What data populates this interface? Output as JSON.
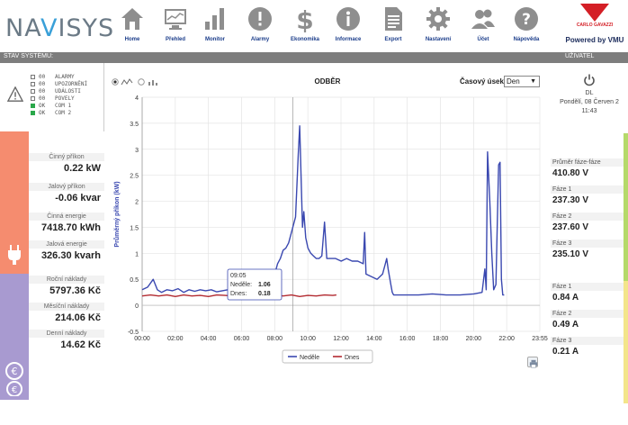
{
  "app": {
    "logo_text": "NAVISYS",
    "brand_name": "CARLO GAVAZZI",
    "powered_by": "Powered by VMU"
  },
  "nav": [
    {
      "label": "Home",
      "icon": "home-icon"
    },
    {
      "label": "Přehled",
      "icon": "monitor-icon"
    },
    {
      "label": "Monitor",
      "icon": "bar-chart-icon"
    },
    {
      "label": "Alarmy",
      "icon": "warning-icon"
    },
    {
      "label": "Ekonomika",
      "icon": "dollar-icon"
    },
    {
      "label": "Informace",
      "icon": "info-icon"
    },
    {
      "label": "Export",
      "icon": "document-icon"
    },
    {
      "label": "Nastavení",
      "icon": "gear-icon"
    },
    {
      "label": "Účet",
      "icon": "users-icon"
    },
    {
      "label": "Nápověda",
      "icon": "help-icon"
    }
  ],
  "bars": {
    "system_status": "STAV SYSTÉMU:",
    "user": "UŽIVATEL"
  },
  "status": {
    "items": [
      {
        "state": "00",
        "label": "ALARMY",
        "active": false
      },
      {
        "state": "00",
        "label": "UPOZORNĚNÍ",
        "active": false
      },
      {
        "state": "00",
        "label": "UDÁLOSTI",
        "active": false
      },
      {
        "state": "00",
        "label": "POVELY",
        "active": false
      },
      {
        "state": "OK",
        "label": "COM 1",
        "active": true
      },
      {
        "state": "OK",
        "label": "COM 2",
        "active": true
      }
    ]
  },
  "left_metrics": {
    "energy": [
      {
        "label": "Činný příkon",
        "value": "0.22 kW"
      },
      {
        "label": "Jalový příkon",
        "value": "-0.06 kvar"
      },
      {
        "label": "Činná energie",
        "value": "7418.70 kWh"
      },
      {
        "label": "Jalová energie",
        "value": "326.30 kvarh"
      }
    ],
    "costs": [
      {
        "label": "Roční náklady",
        "value": "5797.36 Kč"
      },
      {
        "label": "Měsíční náklady",
        "value": "214.06 Kč"
      },
      {
        "label": "Denní náklady",
        "value": "14.62 Kč"
      }
    ]
  },
  "user": {
    "name": "DL",
    "date": "Pondělí, 08 Červen 2",
    "time": "11:43"
  },
  "right_metrics": {
    "voltage_title": "Průměr fáze-fáze",
    "voltage_avg": "410.80 V",
    "voltages": [
      {
        "label": "Fáze 1",
        "value": "237.30 V"
      },
      {
        "label": "Fáze 2",
        "value": "237.60 V"
      },
      {
        "label": "Fáze 3",
        "value": "235.10 V"
      }
    ],
    "currents": [
      {
        "label": "Fáze 1",
        "value": "0.84 A"
      },
      {
        "label": "Fáze 2",
        "value": "0.49 A"
      },
      {
        "label": "Fáze 3",
        "value": "0.21 A"
      }
    ]
  },
  "chart_controls": {
    "title": "ODBĚR",
    "period_label": "Časový úsek",
    "period_value": "Den"
  },
  "chart_data": {
    "type": "line",
    "title": "ODBĚR",
    "ylabel": "Průměrný příkon (kW)",
    "xlabel": "",
    "ylim": [
      -0.5,
      4
    ],
    "yticks": [
      -0.5,
      0,
      0.5,
      1,
      1.5,
      2,
      2.5,
      3,
      3.5,
      4
    ],
    "xlim": [
      0,
      1439
    ],
    "xticks": [
      "00:00",
      "02:00",
      "04:00",
      "06:00",
      "08:00",
      "10:00",
      "12:00",
      "14:00",
      "16:00",
      "18:00",
      "20:00",
      "22:00",
      "23:55"
    ],
    "grid": true,
    "legend_position": "bottom",
    "tooltip": {
      "time": "09:05",
      "lines": [
        {
          "name": "Neděle",
          "value": "1.06"
        },
        {
          "name": "Dnes",
          "value": "0.18"
        }
      ]
    },
    "series": [
      {
        "name": "Neděle",
        "color": "#3a48b0",
        "points": [
          [
            0,
            0.3
          ],
          [
            20,
            0.35
          ],
          [
            40,
            0.5
          ],
          [
            55,
            0.3
          ],
          [
            70,
            0.25
          ],
          [
            90,
            0.3
          ],
          [
            110,
            0.28
          ],
          [
            130,
            0.32
          ],
          [
            150,
            0.25
          ],
          [
            170,
            0.3
          ],
          [
            190,
            0.27
          ],
          [
            210,
            0.3
          ],
          [
            230,
            0.28
          ],
          [
            250,
            0.3
          ],
          [
            270,
            0.26
          ],
          [
            290,
            0.28
          ],
          [
            310,
            0.3
          ],
          [
            330,
            0.3
          ],
          [
            350,
            0.28
          ],
          [
            370,
            0.3
          ],
          [
            390,
            0.6
          ],
          [
            400,
            0.3
          ],
          [
            420,
            0.3
          ],
          [
            440,
            0.35
          ],
          [
            455,
            0.4
          ],
          [
            470,
            0.55
          ],
          [
            480,
            0.6
          ],
          [
            490,
            0.8
          ],
          [
            500,
            0.9
          ],
          [
            510,
            1.06
          ],
          [
            520,
            1.1
          ],
          [
            530,
            1.2
          ],
          [
            540,
            1.4
          ],
          [
            555,
            1.7
          ],
          [
            565,
            2.9
          ],
          [
            570,
            3.45
          ],
          [
            575,
            2.5
          ],
          [
            580,
            1.5
          ],
          [
            585,
            1.8
          ],
          [
            592,
            1.3
          ],
          [
            600,
            1.1
          ],
          [
            610,
            1.0
          ],
          [
            620,
            0.95
          ],
          [
            630,
            0.9
          ],
          [
            640,
            0.9
          ],
          [
            650,
            0.95
          ],
          [
            660,
            1.6
          ],
          [
            668,
            0.9
          ],
          [
            680,
            0.9
          ],
          [
            700,
            0.9
          ],
          [
            720,
            0.85
          ],
          [
            740,
            0.9
          ],
          [
            760,
            0.85
          ],
          [
            780,
            0.85
          ],
          [
            800,
            0.8
          ],
          [
            805,
            1.4
          ],
          [
            810,
            0.6
          ],
          [
            830,
            0.55
          ],
          [
            850,
            0.5
          ],
          [
            870,
            0.6
          ],
          [
            880,
            0.8
          ],
          [
            885,
            0.9
          ],
          [
            890,
            0.7
          ],
          [
            900,
            0.4
          ],
          [
            905,
            0.25
          ],
          [
            910,
            0.2
          ],
          [
            950,
            0.2
          ],
          [
            1000,
            0.2
          ],
          [
            1050,
            0.22
          ],
          [
            1100,
            0.2
          ],
          [
            1150,
            0.2
          ],
          [
            1200,
            0.22
          ],
          [
            1230,
            0.25
          ],
          [
            1240,
            0.7
          ],
          [
            1245,
            0.3
          ],
          [
            1250,
            2.95
          ],
          [
            1258,
            2.0
          ],
          [
            1265,
            1.0
          ],
          [
            1272,
            0.3
          ],
          [
            1280,
            0.4
          ],
          [
            1290,
            2.7
          ],
          [
            1295,
            2.75
          ],
          [
            1300,
            0.5
          ],
          [
            1305,
            0.2
          ],
          [
            1310,
            0.2
          ]
        ]
      },
      {
        "name": "Dnes",
        "color": "#b22a30",
        "points": [
          [
            0,
            0.18
          ],
          [
            30,
            0.2
          ],
          [
            60,
            0.18
          ],
          [
            90,
            0.2
          ],
          [
            120,
            0.17
          ],
          [
            150,
            0.2
          ],
          [
            180,
            0.18
          ],
          [
            210,
            0.19
          ],
          [
            240,
            0.17
          ],
          [
            270,
            0.2
          ],
          [
            300,
            0.19
          ],
          [
            330,
            0.18
          ],
          [
            350,
            0.2
          ],
          [
            360,
            0.45
          ],
          [
            365,
            0.55
          ],
          [
            370,
            0.2
          ],
          [
            390,
            0.18
          ],
          [
            420,
            0.2
          ],
          [
            450,
            0.17
          ],
          [
            480,
            0.2
          ],
          [
            510,
            0.18
          ],
          [
            540,
            0.2
          ],
          [
            570,
            0.17
          ],
          [
            600,
            0.19
          ],
          [
            630,
            0.18
          ],
          [
            660,
            0.2
          ],
          [
            690,
            0.19
          ],
          [
            703,
            0.2
          ]
        ]
      }
    ]
  }
}
